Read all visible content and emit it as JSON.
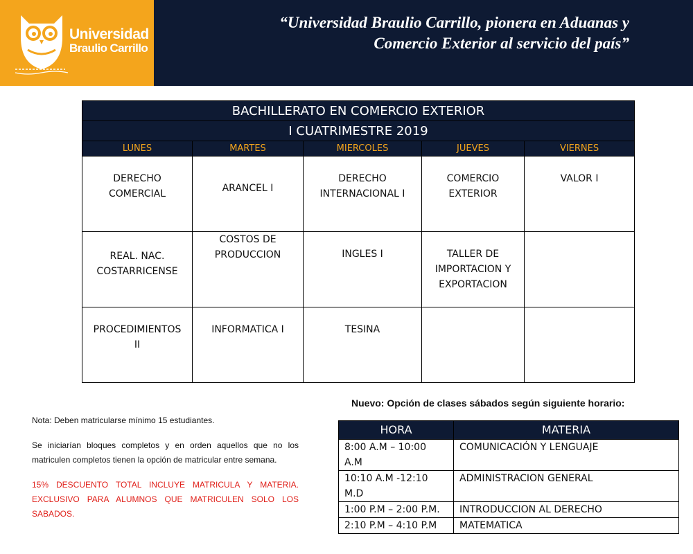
{
  "header": {
    "logo_line1": "Universidad",
    "logo_line2": "Braulio Carrillo",
    "slogan_line1": "“Universidad Braulio Carrillo, pionera en Aduanas y",
    "slogan_line2": "Comercio Exterior al servicio del país”",
    "colors": {
      "navy": "#0e1a33",
      "orange": "#f4a51c"
    }
  },
  "schedule": {
    "title": "BACHILLERATO EN COMERCIO EXTERIOR",
    "term": "I CUATRIMESTRE 2019",
    "days": [
      "LUNES",
      "MARTES",
      "MIERCOLES",
      "JUEVES",
      "VIERNES"
    ],
    "rows": [
      {
        "cells": [
          {
            "lines": [
              "DERECHO",
              "COMERCIAL"
            ]
          },
          {
            "lines": [
              "ARANCEL I"
            ]
          },
          {
            "lines": [
              "DERECHO",
              "INTERNACIONAL I"
            ]
          },
          {
            "lines": [
              "COMERCIO",
              "EXTERIOR"
            ]
          },
          {
            "lines": [
              "VALOR I"
            ]
          }
        ]
      },
      {
        "cells": [
          {
            "lines": [
              "REAL. NAC.",
              "COSTARRICENSE"
            ]
          },
          {
            "lines": [
              "COSTOS DE",
              "PRODUCCION"
            ]
          },
          {
            "lines": [
              "INGLES I"
            ]
          },
          {
            "lines": [
              "TALLER DE",
              "IMPORTACION Y",
              "EXPORTACION"
            ]
          },
          {
            "lines": []
          }
        ]
      },
      {
        "cells": [
          {
            "lines": [
              "PROCEDIMIENTOS",
              "II"
            ]
          },
          {
            "lines": [
              "INFORMATICA I"
            ]
          },
          {
            "lines": [
              "TESINA"
            ]
          },
          {
            "lines": []
          },
          {
            "lines": []
          }
        ]
      }
    ]
  },
  "notes": {
    "note1": "Nota: Deben matricularse mínimo  15 estudiantes.",
    "note2": "Se iniciarían bloques completos y en orden aquellos que no los matriculen completos tienen la opción de matricular entre semana.",
    "note3": "15% DESCUENTO TOTAL INCLUYE MATRICULA Y MATERIA. EXCLUSIVO PARA ALUMNOS QUE MATRICULEN SOLO LOS SABADOS."
  },
  "saturday": {
    "heading": "Nuevo: Opción de clases sábados según siguiente horario:",
    "col_hora": "HORA",
    "col_materia": "MATERIA",
    "rows": [
      {
        "hora_lines": [
          "8:00 A.M – 10:00",
          "A.M"
        ],
        "materia": "COMUNICACIÓN Y LENGUAJE"
      },
      {
        "hora_lines": [
          "10:10 A.M -12:10",
          "M.D"
        ],
        "materia": "ADMINISTRACION GENERAL"
      },
      {
        "hora_lines": [
          "1:00 P.M – 2:00 P.M."
        ],
        "materia": "INTRODUCCION AL DERECHO"
      },
      {
        "hora_lines": [
          "2:10 P.M – 4:10 P.M"
        ],
        "materia": "MATEMATICA"
      }
    ]
  }
}
